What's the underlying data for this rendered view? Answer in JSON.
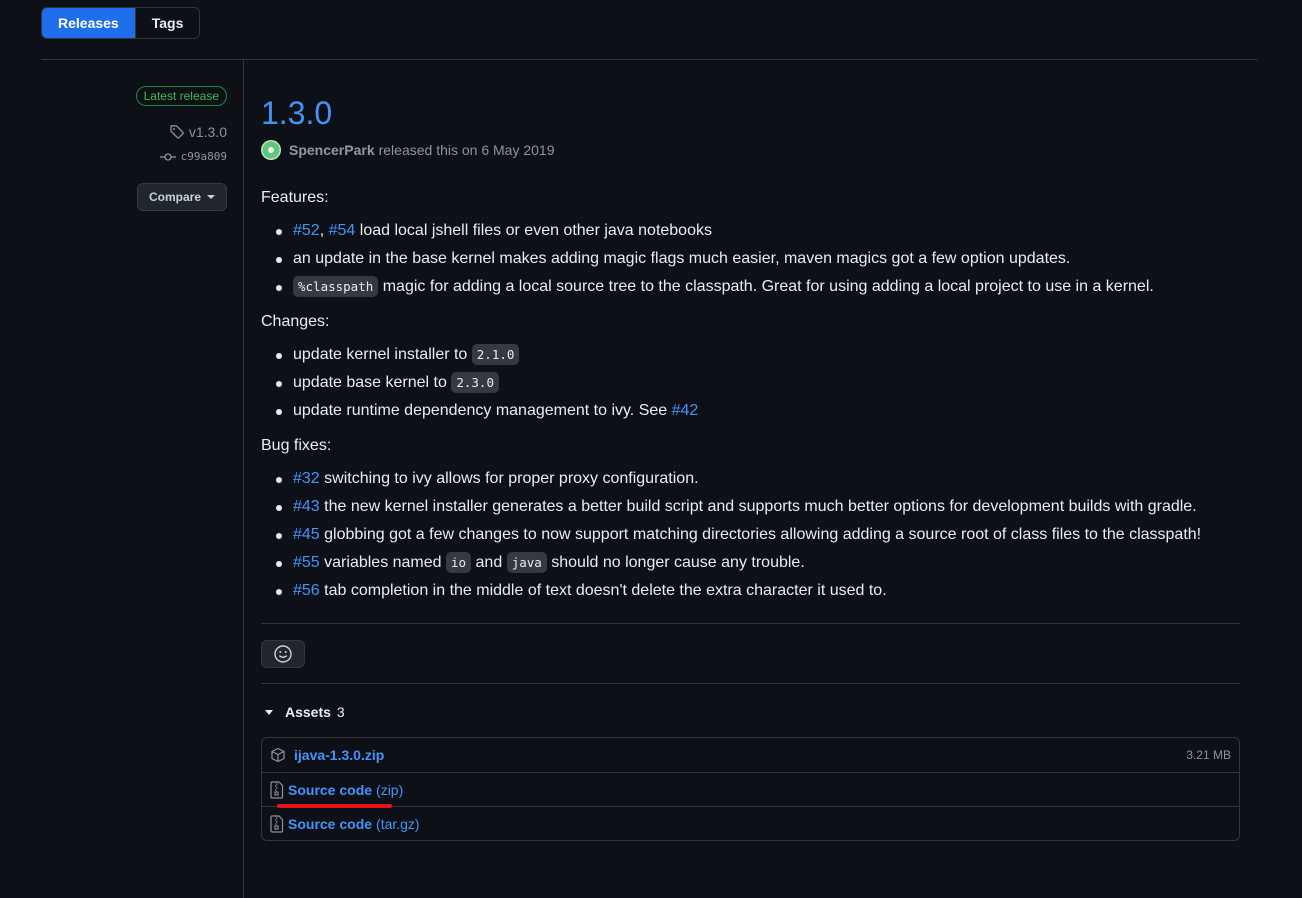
{
  "tabs": [
    {
      "label": "Releases",
      "active": true
    },
    {
      "label": "Tags",
      "active": false
    }
  ],
  "meta": {
    "badge": "Latest release",
    "tag": "v1.3.0",
    "commit": "c99a809",
    "compare_label": "Compare"
  },
  "release": {
    "title": "1.3.0",
    "author": "SpencerPark",
    "released_text": "released this on 6 May 2019"
  },
  "features": {
    "label": "Features:",
    "items": [
      {
        "link1": "#52",
        "sep": ",",
        "link2": "#54",
        "text": "load local jshell files or even other java notebooks"
      },
      {
        "text": "an update in the base kernel makes adding magic flags much easier, maven magics got a few option updates."
      },
      {
        "code": "%classpath",
        "text": "magic for adding a local source tree to the classpath. Great for using adding a local project to use in a kernel."
      }
    ]
  },
  "changes": {
    "label": "Changes:",
    "items": [
      {
        "text": "update kernel installer to",
        "code": "2.1.0"
      },
      {
        "text": "update base kernel to",
        "code": "2.3.0"
      },
      {
        "text": "update runtime dependency management to ivy. See",
        "link": "#42"
      }
    ]
  },
  "bugfixes": {
    "label": "Bug fixes:",
    "items": [
      {
        "link": "#32",
        "text": "switching to ivy allows for proper proxy configuration."
      },
      {
        "link": "#43",
        "text": "the new kernel installer generates a better build script and supports much better options for development builds with gradle."
      },
      {
        "link": "#45",
        "text": "globbing got a few changes to now support matching directories allowing adding a source root of class files to the classpath!"
      },
      {
        "link": "#55",
        "pre": "variables named",
        "code1": "io",
        "mid": "and",
        "code2": "java",
        "post": "should no longer cause any trouble."
      },
      {
        "link": "#56",
        "text": "tab completion in the middle of text doesn't delete the extra character it used to."
      }
    ]
  },
  "assets": {
    "label": "Assets",
    "count": "3",
    "rows": [
      {
        "name": "ijava-1.3.0.zip",
        "size": "3.21 MB"
      },
      {
        "name": "Source code",
        "format": "(zip)"
      },
      {
        "name": "Source code",
        "format": "(tar.gz)"
      }
    ]
  },
  "colors": {
    "accent": "#4493f8",
    "active_tab": "#1f6feb",
    "badge_green": "#3fb950",
    "annotation_red": "#e5141a"
  },
  "icons": [
    "tag-icon",
    "commit-icon",
    "smiley-icon",
    "package-icon",
    "file-zip-icon"
  ]
}
